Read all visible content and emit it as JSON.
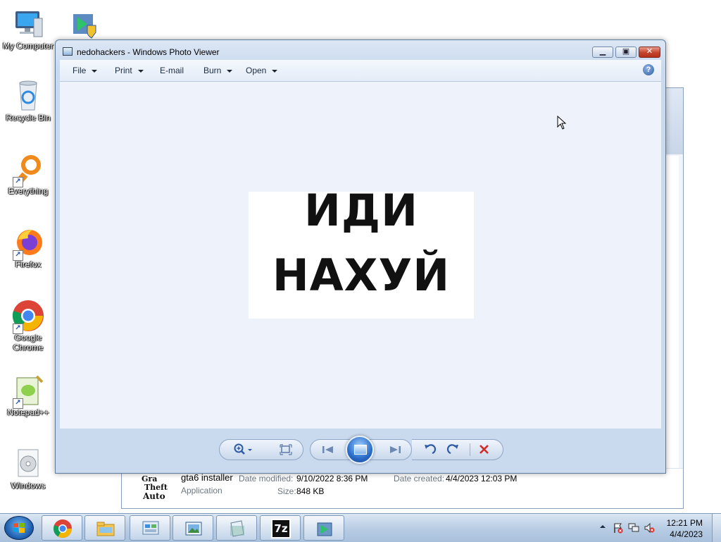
{
  "desktop": {
    "icons": [
      {
        "label": "My Computer",
        "icon": "computer-icon"
      },
      {
        "label": "",
        "icon": "installer-shield-icon"
      },
      {
        "label": "Recycle Bin",
        "icon": "recycle-bin-icon"
      },
      {
        "label": "Everything",
        "icon": "everything-search-icon"
      },
      {
        "label": "Firefox",
        "icon": "firefox-icon"
      },
      {
        "label": "Google Chrome",
        "icon": "chrome-icon"
      },
      {
        "label": "Notepad++",
        "icon": "notepadpp-icon"
      },
      {
        "label": "Windows",
        "icon": "disc-icon"
      }
    ]
  },
  "photo_viewer": {
    "title": "nedohackers - Windows Photo Viewer",
    "menu": {
      "file": "File",
      "print": "Print",
      "email": "E-mail",
      "burn": "Burn",
      "open": "Open"
    },
    "help": "?",
    "image_text": {
      "line1": "ИДИ",
      "line2": "НАХУЙ"
    },
    "controls": {
      "zoom": "zoom-icon",
      "actual_size": "actual-size-icon",
      "previous": "previous-icon",
      "slideshow": "slideshow-icon",
      "next": "next-icon",
      "rotate_ccw": "rotate-ccw-icon",
      "rotate_cw": "rotate-cw-icon",
      "delete": "delete-icon"
    }
  },
  "details_pane": {
    "file_name": "gta6 installer",
    "file_type": "Application",
    "date_modified_label": "Date modified:",
    "date_modified": "9/10/2022 8:36 PM",
    "date_created_label": "Date created:",
    "date_created": "4/4/2023 12:03 PM",
    "size_label": "Size:",
    "size": "848 KB",
    "logo_text": "Grand Theft Auto"
  },
  "taskbar": {
    "pinned": [
      "chrome-icon",
      "explorer-icon",
      "control-panel-icon",
      "photo-viewer-icon",
      "notepad-icon",
      "7zip-icon",
      "installer-icon"
    ],
    "seven_zip_label": "7z",
    "clock_time": "12:21 PM",
    "clock_date": "4/4/2023"
  },
  "colors": {
    "window_frame": "#c9d9ee",
    "close_button": "#c4432c",
    "taskbar": "#b9cde4",
    "delete_x": "#d22b2b"
  }
}
